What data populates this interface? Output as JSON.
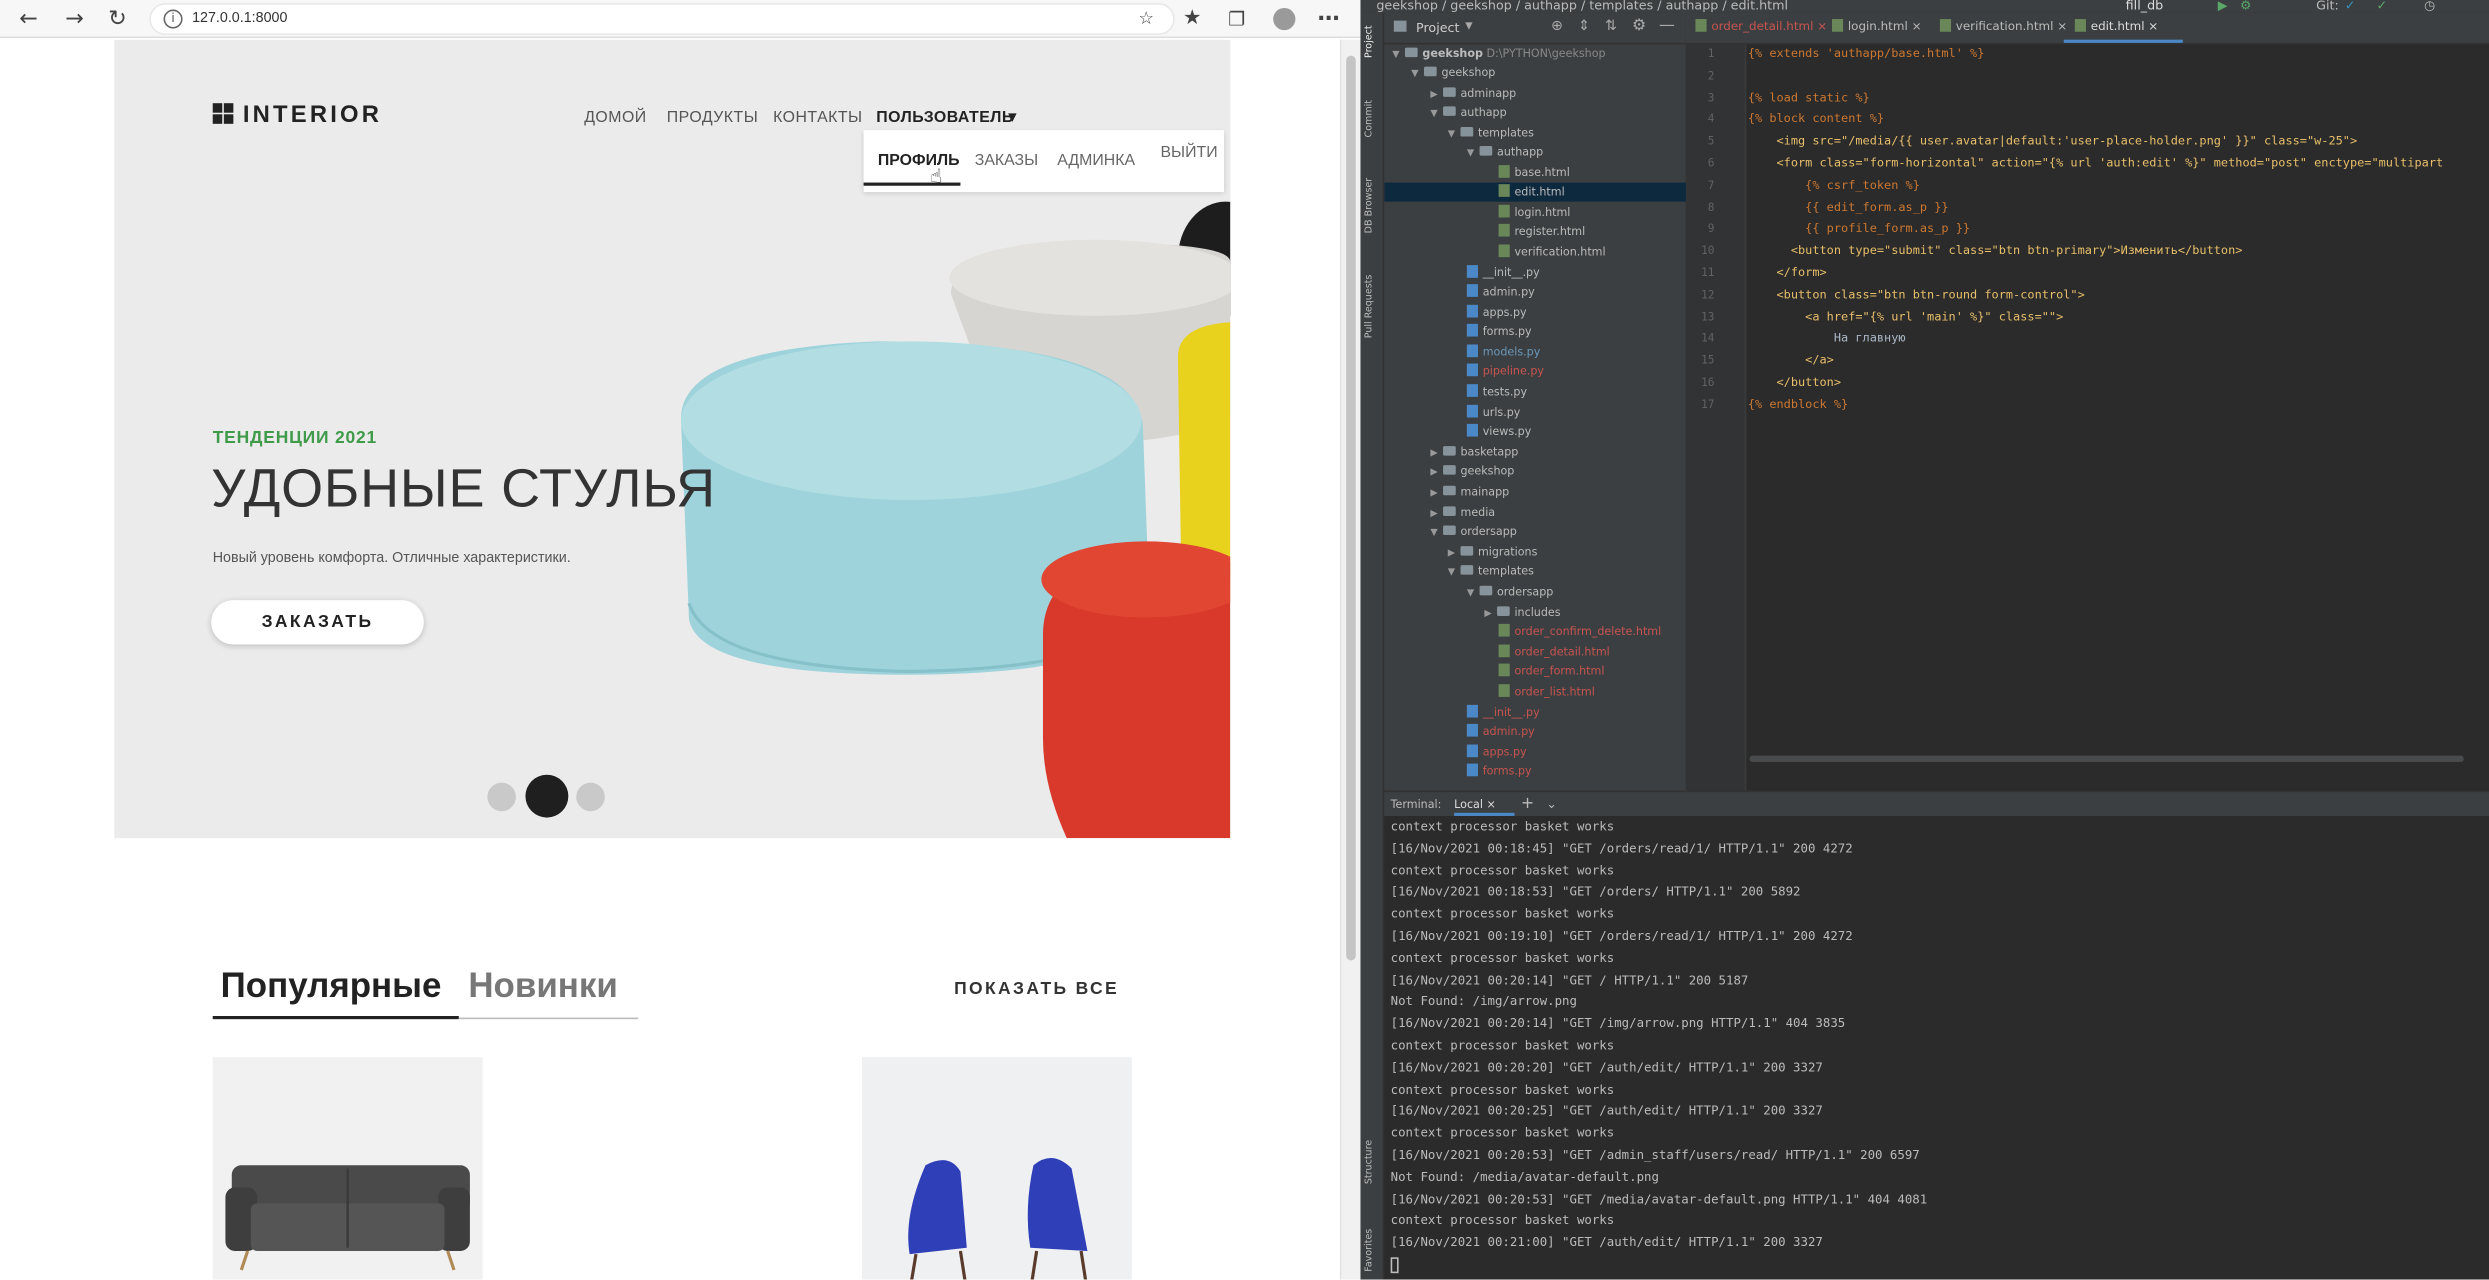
{
  "browser": {
    "url": "127.0.0.1:8000"
  },
  "site": {
    "logo": "INTERIOR",
    "nav": [
      "ДОМОЙ",
      "ПРОДУКТЫ",
      "КОНТАКТЫ",
      "ПОЛЬЗОВАТЕЛЬ"
    ],
    "user_menu": [
      "ПРОФИЛЬ",
      "ЗАКАЗЫ",
      "АДМИНКА",
      "ВЫЙТИ"
    ],
    "hero": {
      "kicker": "ТЕНДЕНЦИИ 2021",
      "title": "УДОБНЫЕ СТУЛЬЯ",
      "subtitle": "Новый уровень комфорта. Отличные характеристики.",
      "button": "ЗАКАЗАТЬ",
      "active_slide": 2,
      "slides": 3
    },
    "tabs": [
      "Популярные",
      "Новинки"
    ],
    "show_all": "ПОКАЗАТЬ ВСЕ"
  },
  "ide": {
    "breadcrumb": "geekshop / geekshop / authapp / templates / authapp / edit.html",
    "run_config": "fill_db",
    "git_label": "Git:",
    "panel_title": "Project",
    "side_tabs": [
      "Project",
      "Commit",
      "DB Browser",
      "Pull Requests",
      "Structure",
      "Favorites"
    ],
    "editor_tabs": [
      "order_detail.html",
      "login.html",
      "verification.html",
      "edit.html"
    ],
    "tree": [
      {
        "label": "geekshop",
        "extra": "D:\\PYTHON\\geekshop"
      },
      {
        "label": "geekshop"
      },
      {
        "label": "adminapp"
      },
      {
        "label": "authapp"
      },
      {
        "label": "templates"
      },
      {
        "label": "authapp"
      },
      {
        "label": "base.html"
      },
      {
        "label": "edit.html"
      },
      {
        "label": "login.html"
      },
      {
        "label": "register.html"
      },
      {
        "label": "verification.html"
      },
      {
        "label": "__init__.py"
      },
      {
        "label": "admin.py"
      },
      {
        "label": "apps.py"
      },
      {
        "label": "forms.py"
      },
      {
        "label": "models.py"
      },
      {
        "label": "pipeline.py"
      },
      {
        "label": "tests.py"
      },
      {
        "label": "urls.py"
      },
      {
        "label": "views.py"
      },
      {
        "label": "basketapp"
      },
      {
        "label": "geekshop"
      },
      {
        "label": "mainapp"
      },
      {
        "label": "media"
      },
      {
        "label": "ordersapp"
      },
      {
        "label": "migrations"
      },
      {
        "label": "templates"
      },
      {
        "label": "ordersapp"
      },
      {
        "label": "includes"
      },
      {
        "label": "order_confirm_delete.html"
      },
      {
        "label": "order_detail.html"
      },
      {
        "label": "order_form.html"
      },
      {
        "label": "order_list.html"
      },
      {
        "label": "__init__.py"
      },
      {
        "label": "admin.py"
      },
      {
        "label": "apps.py"
      },
      {
        "label": "forms.py"
      }
    ],
    "code_lines": [
      "{% extends 'authapp/base.html' %}",
      "",
      "{% load static %}",
      "{% block content %}",
      "    <img src=\"/media/{{ user.avatar|default:'user-place-holder.png' }}\" class=\"w-25\">",
      "    <form class=\"form-horizontal\" action=\"{% url 'auth:edit' %}\" method=\"post\" enctype=\"multipart",
      "        {% csrf_token %}",
      "        {{ edit_form.as_p }}",
      "        {{ profile_form.as_p }}",
      "      <button type=\"submit\" class=\"btn btn-primary\">Изменить</button>",
      "    </form>",
      "    <button class=\"btn btn-round form-control\">",
      "        <a href=\"{% url 'main' %}\" class=\"\">",
      "            На главную",
      "        </a>",
      "    </button>",
      "{% endblock %}"
    ],
    "terminal_label": "Terminal:",
    "terminal_tab": "Local",
    "terminal_lines": [
      "context processor basket works",
      "[16/Nov/2021 00:18:45] \"GET /orders/read/1/ HTTP/1.1\" 200 4272",
      "context processor basket works",
      "[16/Nov/2021 00:18:53] \"GET /orders/ HTTP/1.1\" 200 5892",
      "context processor basket works",
      "[16/Nov/2021 00:19:10] \"GET /orders/read/1/ HTTP/1.1\" 200 4272",
      "context processor basket works",
      "[16/Nov/2021 00:20:14] \"GET / HTTP/1.1\" 200 5187",
      "Not Found: /img/arrow.png",
      "[16/Nov/2021 00:20:14] \"GET /img/arrow.png HTTP/1.1\" 404 3835",
      "context processor basket works",
      "[16/Nov/2021 00:20:20] \"GET /auth/edit/ HTTP/1.1\" 200 3327",
      "context processor basket works",
      "[16/Nov/2021 00:20:25] \"GET /auth/edit/ HTTP/1.1\" 200 3327",
      "context processor basket works",
      "[16/Nov/2021 00:20:53] \"GET /admin_staff/users/read/ HTTP/1.1\" 200 6597",
      "Not Found: /media/avatar-default.png",
      "[16/Nov/2021 00:20:53] \"GET /media/avatar-default.png HTTP/1.1\" 404 4081",
      "context processor basket works",
      "[16/Nov/2021 00:21:00] \"GET /auth/edit/ HTTP/1.1\" 200 3327"
    ]
  }
}
